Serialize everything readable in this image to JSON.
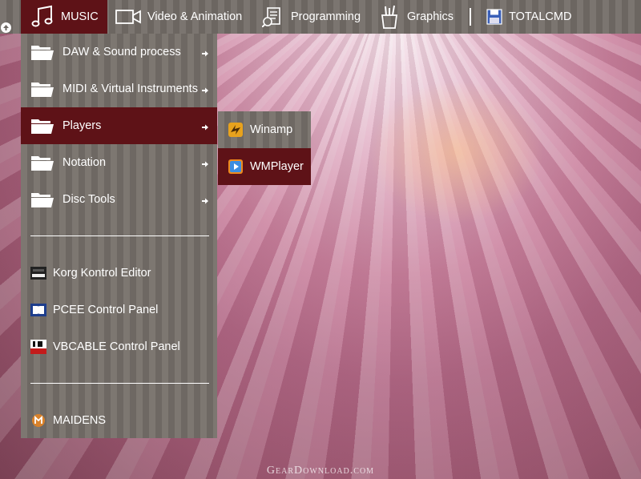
{
  "topbar": {
    "items": [
      {
        "label": "MUSIC",
        "icon": "music-note-icon"
      },
      {
        "label": "Video & Animation",
        "icon": "video-camera-icon"
      },
      {
        "label": "Programming",
        "icon": "programming-icon"
      },
      {
        "label": "Graphics",
        "icon": "brush-cup-icon"
      },
      {
        "label": "TOTALCMD",
        "icon": "floppy-disk-icon"
      }
    ]
  },
  "menu": {
    "folders": [
      {
        "label": "DAW & Sound process"
      },
      {
        "label": "MIDI & Virtual Instruments"
      },
      {
        "label": "Players"
      },
      {
        "label": "Notation"
      },
      {
        "label": "Disc Tools"
      }
    ],
    "apps": [
      {
        "label": "Korg Kontrol Editor",
        "icon": "korg-editor-icon"
      },
      {
        "label": "PCEE Control Panel",
        "icon": "dolby-icon"
      },
      {
        "label": "VBCABLE Control Panel",
        "icon": "vb-audio-icon"
      }
    ],
    "footer": {
      "label": "MAIDENS",
      "icon": "maidens-icon"
    }
  },
  "submenu": {
    "items": [
      {
        "label": "Winamp",
        "icon": "winamp-icon"
      },
      {
        "label": "WMPlayer",
        "icon": "wmplayer-icon"
      }
    ]
  },
  "watermark": "GearDownload.com",
  "colors": {
    "active": "#5e1217",
    "bar": "#75706b",
    "text": "#ffffff"
  }
}
